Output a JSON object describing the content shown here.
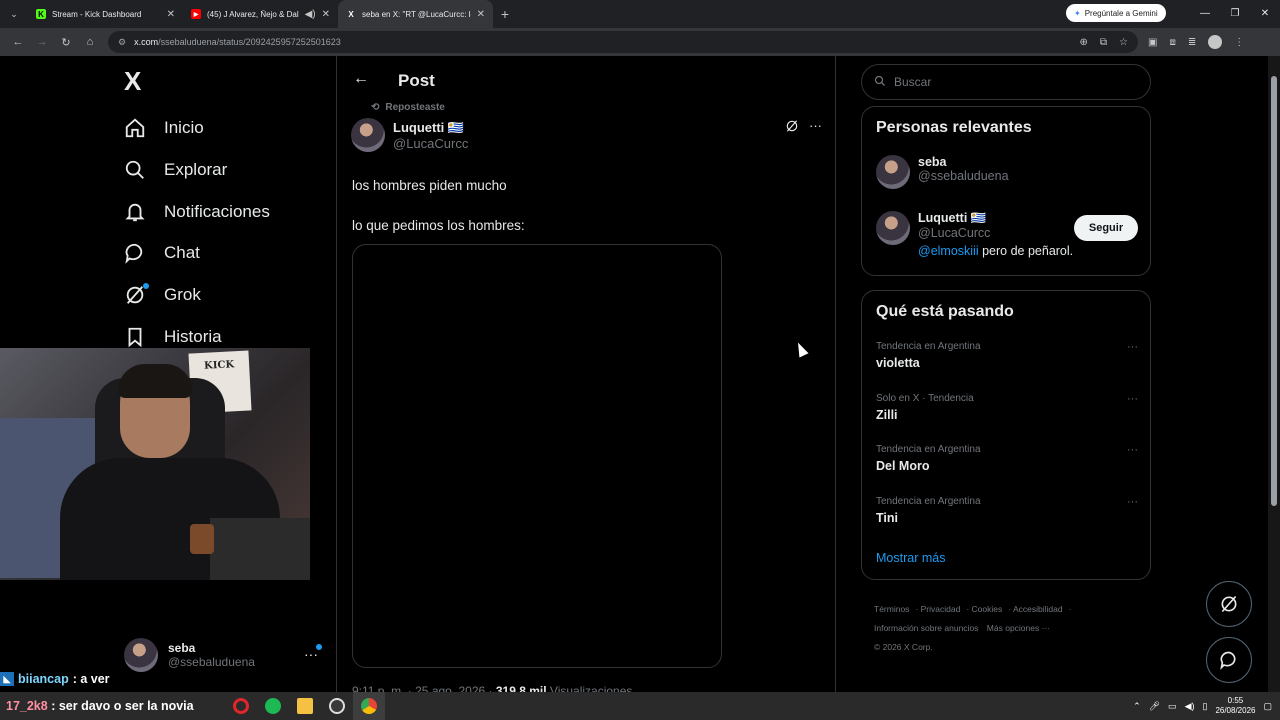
{
  "browser": {
    "tabs": [
      {
        "title": "Stream - Kick Dashboard",
        "fav_color": "#53fc18",
        "fav_glyph": "K"
      },
      {
        "title": "(45) J Alvarez, Ñejo & Dalm",
        "fav_color": "#ff0000",
        "fav_glyph": "▶"
      },
      {
        "title": "seba en X: \"RT @LucaCurcc: lo",
        "fav_color": "#000000",
        "fav_glyph": "X"
      }
    ],
    "gemini_label": "Pregúntale a Gemini",
    "url_host": "x.com",
    "url_path": "/ssebaluduena/status/2092425957252501623"
  },
  "nav": {
    "logo": "X",
    "items": [
      {
        "label": "Inicio",
        "icon": "home-icon"
      },
      {
        "label": "Explorar",
        "icon": "search-icon"
      },
      {
        "label": "Notificaciones",
        "icon": "bell-icon"
      },
      {
        "label": "Chat",
        "icon": "chat-icon"
      },
      {
        "label": "Grok",
        "icon": "grok-icon"
      },
      {
        "label": "Historia",
        "icon": "bookmark-icon"
      }
    ],
    "account": {
      "name": "seba",
      "handle": "@ssebaluduena",
      "more": "···"
    }
  },
  "webcam": {
    "poster_text": "KICK"
  },
  "post": {
    "header_title": "Post",
    "reposted_label": "Reposteaste",
    "author_name": "Luquetti 🇺🇾",
    "author_handle": "@LucaCurcc",
    "text_line1": "los hombres piden mucho",
    "text_line2": "lo que pedimos los hombres:",
    "timestamp": "9:11 p. m. · 25 ago. 2026 · ",
    "views_count": "319,8 mil",
    "views_label": " Visualizaciones"
  },
  "sidebar": {
    "search_placeholder": "Buscar",
    "relevant": {
      "title": "Personas relevantes",
      "people": [
        {
          "name": "seba",
          "handle": "@ssebaluduena"
        },
        {
          "name": "Luquetti 🇺🇾",
          "handle": "@LucaCurcc",
          "bio_mention": "@elmoskiii",
          "bio_text": " pero de peñarol."
        }
      ],
      "follow_label": "Seguir"
    },
    "trends": {
      "title": "Qué está pasando",
      "items": [
        {
          "context": "Tendencia en Argentina",
          "topic": "violetta"
        },
        {
          "context": "Solo en X · Tendencia",
          "topic": "Zilli"
        },
        {
          "context": "Tendencia en Argentina",
          "topic": "Del Moro"
        },
        {
          "context": "Tendencia en Argentina",
          "topic": "Tini"
        }
      ],
      "show_more": "Mostrar más"
    },
    "footer": {
      "links": [
        "Términos",
        "Privacidad",
        "Cookies",
        "Accesibilidad",
        "Información sobre anuncios",
        "Más opciones ···"
      ],
      "copyright": "© 2026 X Corp."
    }
  },
  "stream_chat": {
    "user": "biiancap",
    "message": " : a ver"
  },
  "taskbar": {
    "overlay_user": "17_2k8",
    "overlay_text": " : ser davo o ser la novia",
    "time": "0:55",
    "date": "26/08/2026"
  },
  "colors": {
    "accent": "#1d9bf0",
    "background": "#000000",
    "border": "#2f3336"
  }
}
